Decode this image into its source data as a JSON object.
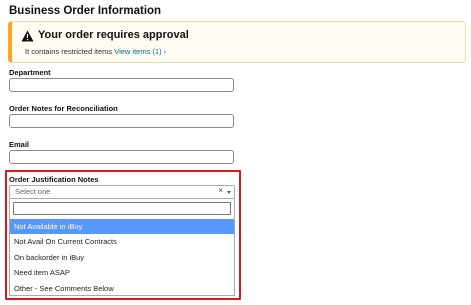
{
  "section": {
    "title": "Business Order Information"
  },
  "alert": {
    "heading": "Your order requires approval",
    "text": "It contains restricted items",
    "link": "View items (1) ›",
    "color": "#ffa41c"
  },
  "fields": {
    "department": {
      "label": "Department",
      "value": ""
    },
    "order_notes": {
      "label": "Order Notes for Reconciliation",
      "value": ""
    },
    "email": {
      "label": "Email",
      "value": ""
    }
  },
  "justification": {
    "label": "Order Justification Notes",
    "placeholder": "Select one",
    "clear_glyph": "×",
    "search_value": "",
    "options": [
      {
        "label": "Not Available in iBuy",
        "highlighted": true
      },
      {
        "label": "Not Avail On Current Contracts",
        "highlighted": false
      },
      {
        "label": "On backorder in iBuy",
        "highlighted": false
      },
      {
        "label": "Need item ASAP",
        "highlighted": false
      },
      {
        "label": "Other - See Comments Below",
        "highlighted": false
      }
    ],
    "highlight_color": "#5897fb",
    "annotation_color": "#d41c1c"
  }
}
